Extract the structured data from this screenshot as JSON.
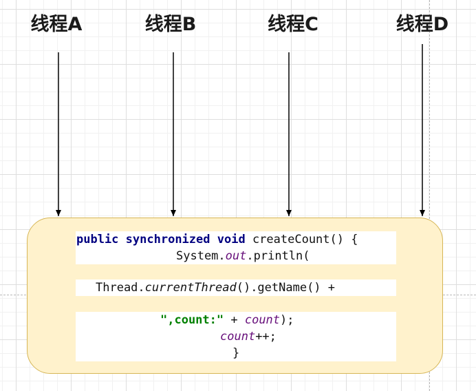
{
  "threads": [
    {
      "label": "线程A"
    },
    {
      "label": "线程B"
    },
    {
      "label": "线程C"
    },
    {
      "label": "线程D"
    }
  ],
  "code": {
    "l1_kw1": "public",
    "l1_kw2": "synchronized",
    "l1_kw3": "void",
    "l1_rest": " createCount() {",
    "l2_pre": "System.",
    "l2_field": "out",
    "l2_post": ".println(",
    "l3_pre": "Thread.",
    "l3_method": "currentThread",
    "l3_post": "().getName() +",
    "l4_str": "\",count:\"",
    "l4_mid": " + ",
    "l4_field": "count",
    "l4_post": ");",
    "l5_field": "count",
    "l5_post": "++;",
    "l6": "}"
  },
  "colors": {
    "keyword": "#000080",
    "field": "#660e7a",
    "string": "#008000",
    "box_fill": "#fff2cc",
    "box_border": "#d6b656"
  }
}
